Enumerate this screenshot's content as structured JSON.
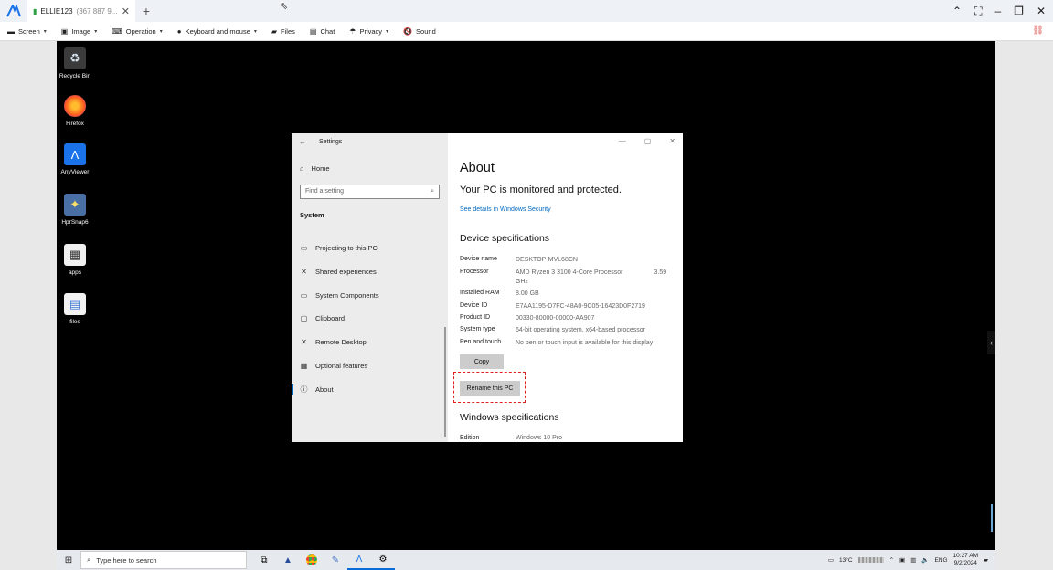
{
  "titlebar": {
    "tab_name": "ELLIE123",
    "tab_id": "(367 887 9...",
    "new_tab": "+",
    "close_tab": "✕"
  },
  "toolbar": {
    "items": [
      {
        "label": "Screen",
        "icon": "monitor-icon",
        "glyph": "▬",
        "caret": "▾"
      },
      {
        "label": "Image",
        "icon": "hd-icon",
        "glyph": "▣",
        "caret": "▾"
      },
      {
        "label": "Operation",
        "icon": "keyboard-icon",
        "glyph": "⌨",
        "caret": "▾"
      },
      {
        "label": "Keyboard and mouse",
        "icon": "mouse-icon",
        "glyph": "●",
        "caret": "▾"
      },
      {
        "label": "Files",
        "icon": "folder-icon",
        "glyph": "▰",
        "caret": ""
      },
      {
        "label": "Chat",
        "icon": "chat-icon",
        "glyph": "▤",
        "caret": ""
      },
      {
        "label": "Privacy",
        "icon": "umbrella-icon",
        "glyph": "☂",
        "caret": "▾"
      },
      {
        "label": "Sound",
        "icon": "mute-icon",
        "glyph": "🔇",
        "caret": ""
      }
    ]
  },
  "desktop_icons": [
    {
      "label": "Recycle Bin",
      "icon": "recycle-bin-icon"
    },
    {
      "label": "Firefox",
      "icon": "firefox-icon"
    },
    {
      "label": "AnyViewer",
      "icon": "anyviewer-icon"
    },
    {
      "label": "HprSnap6",
      "icon": "hypersnap-icon"
    },
    {
      "label": "apps",
      "icon": "apps-icon"
    },
    {
      "label": "files",
      "icon": "files-icon"
    }
  ],
  "settings": {
    "title": "Settings",
    "nav": {
      "home": "Home",
      "search_placeholder": "Find a setting",
      "section": "System",
      "items": [
        {
          "label": "Projecting to this PC",
          "glyph": "▭"
        },
        {
          "label": "Shared experiences",
          "glyph": "✕"
        },
        {
          "label": "System Components",
          "glyph": "▭"
        },
        {
          "label": "Clipboard",
          "glyph": "▢"
        },
        {
          "label": "Remote Desktop",
          "glyph": "✕"
        },
        {
          "label": "Optional features",
          "glyph": "▦"
        },
        {
          "label": "About",
          "glyph": "ⓘ"
        }
      ]
    },
    "content": {
      "heading": "About",
      "status": "Your PC is monitored and protected.",
      "security_link": "See details in Windows Security",
      "device_heading": "Device specifications",
      "specs": [
        {
          "key": "Device name",
          "value": "DESKTOP-MVL68CN"
        },
        {
          "key": "Processor",
          "value": "AMD Ryzen 3 3100 4-Core Processor",
          "value_extra": "3.59",
          "value_line2": "GHz"
        },
        {
          "key": "Installed RAM",
          "value": "8.00 GB"
        },
        {
          "key": "Device ID",
          "value": "E7AA1195-D7FC-48A0-9C05-16423D0F2719"
        },
        {
          "key": "Product ID",
          "value": "00330-80000-00000-AA907"
        },
        {
          "key": "System type",
          "value": "64-bit operating system, x64-based processor"
        },
        {
          "key": "Pen and touch",
          "value": "No pen or touch input is available for this display"
        }
      ],
      "copy_button": "Copy",
      "rename_button": "Rename this PC",
      "windows_heading": "Windows specifications",
      "edition_key": "Edition",
      "edition_value": "Windows 10 Pro"
    }
  },
  "taskbar": {
    "search_placeholder": "Type here to search",
    "weather": "13°C",
    "language": "ENG",
    "time": "10:27 AM",
    "date": "9/2/2024"
  },
  "colors": {
    "accent": "#0067c0",
    "highlight": "#e02020",
    "desktop": "#000000"
  }
}
